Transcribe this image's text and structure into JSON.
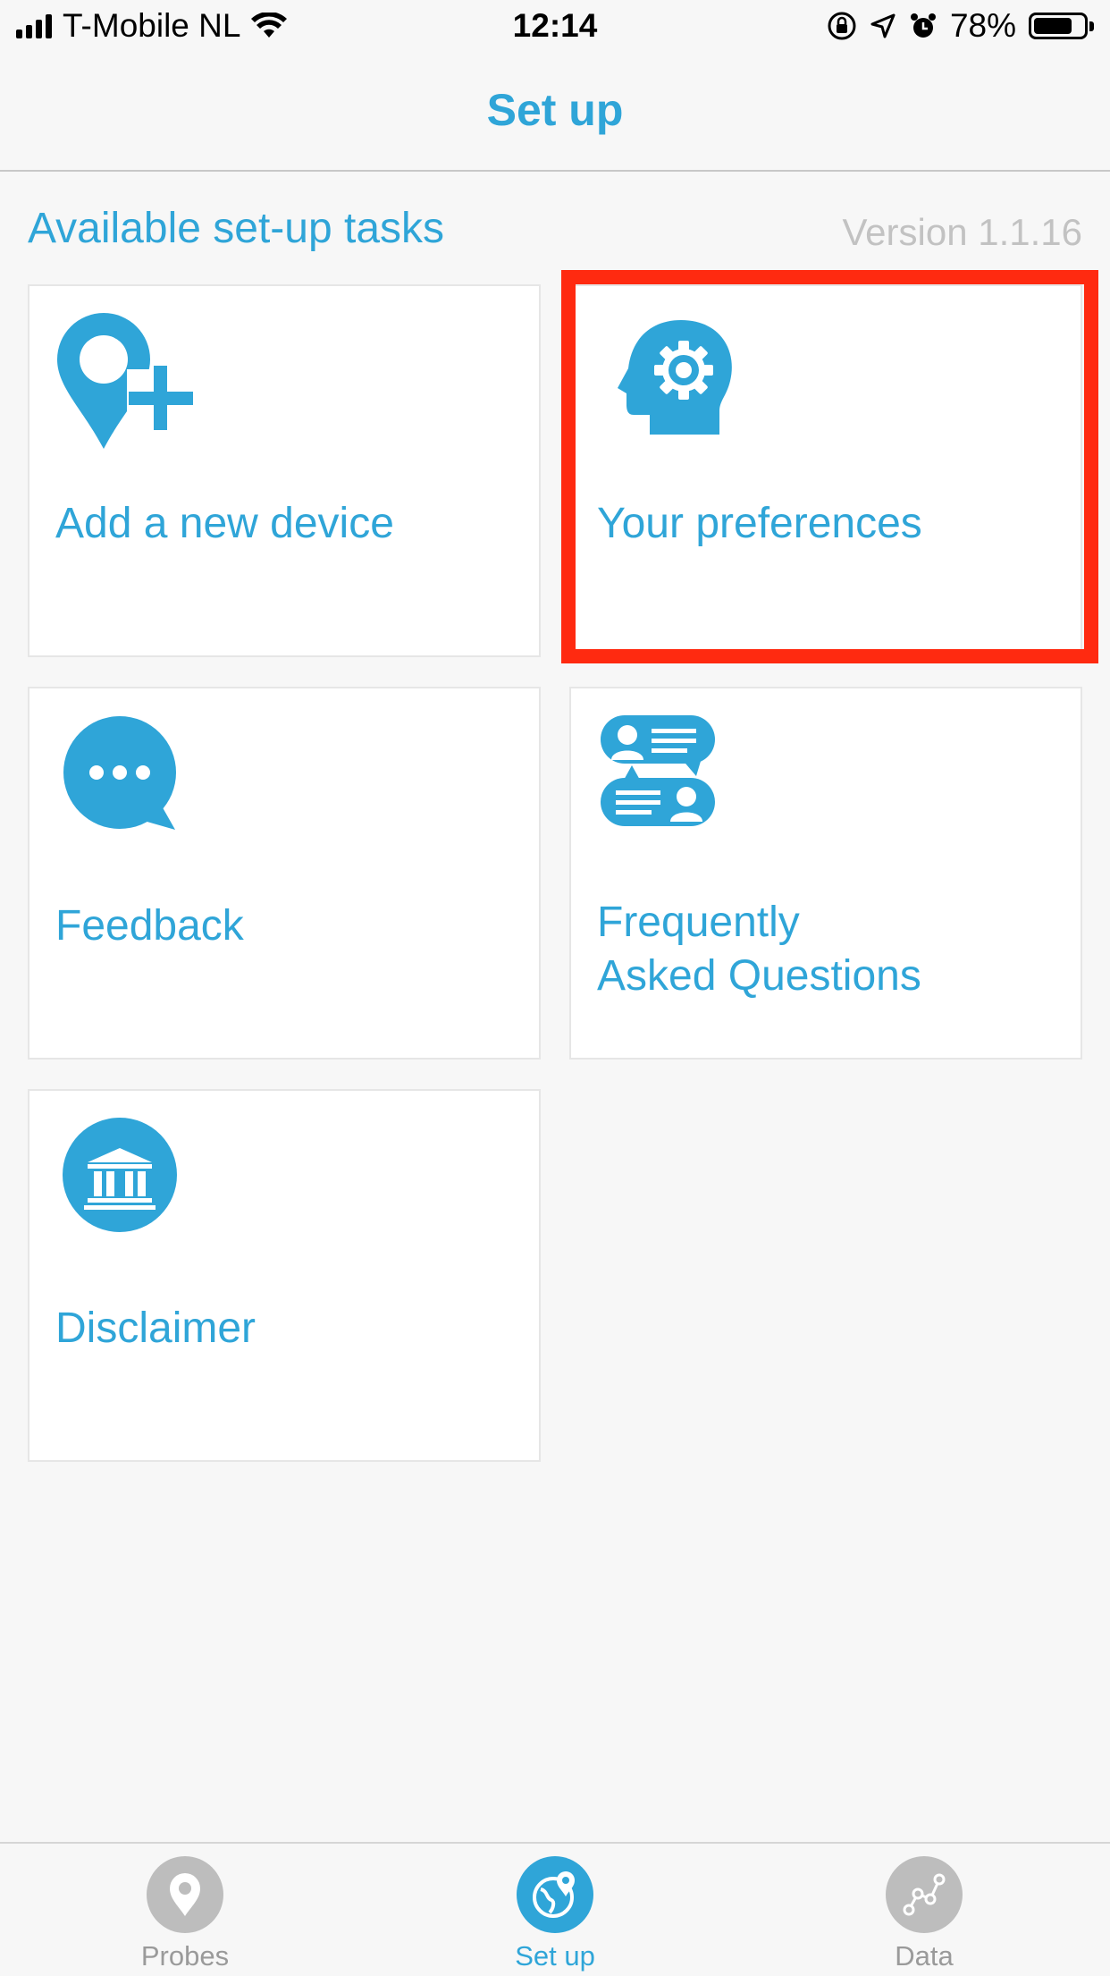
{
  "status_bar": {
    "carrier": "T-Mobile NL",
    "time": "12:14",
    "battery": "78%",
    "battery_level": 0.78
  },
  "nav": {
    "title": "Set up"
  },
  "section": {
    "title": "Available set-up tasks",
    "version": "Version 1.1.16"
  },
  "tiles": [
    {
      "label": "Add a new device",
      "icon": "location-pin-plus-icon"
    },
    {
      "label": "Your preferences",
      "icon": "head-gear-icon"
    },
    {
      "label": "Feedback",
      "icon": "chat-bubble-icon"
    },
    {
      "label_line1": "Frequently",
      "label_line2": "Asked Questions",
      "icon": "faq-people-icon"
    },
    {
      "label": "Disclaimer",
      "icon": "bank-building-icon"
    }
  ],
  "tabbar": {
    "items": [
      {
        "label": "Probes",
        "icon": "location-pin-icon"
      },
      {
        "label": "Set up",
        "icon": "globe-pin-icon",
        "active": true
      },
      {
        "label": "Data",
        "icon": "graph-nodes-icon"
      }
    ]
  },
  "colors": {
    "accent": "#2fa5d8",
    "highlight": "#ff2a10",
    "inactive_tab": "#bdbdbd",
    "version_text": "#c2c2c2"
  }
}
